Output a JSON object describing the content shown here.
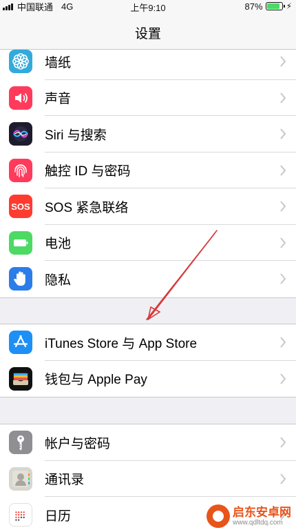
{
  "status_bar": {
    "carrier": "中国联通",
    "network": "4G",
    "time": "上午9:10",
    "battery_percent": "87%",
    "battery_level": 0.87,
    "charging_icon": "bolt-icon"
  },
  "nav": {
    "title": "设置"
  },
  "groups": [
    {
      "items": [
        {
          "label": "墙纸",
          "icon": "wallpaper-flower-icon",
          "color": "#34aadc"
        },
        {
          "label": "声音",
          "icon": "speaker-icon",
          "color": "#ff3b5c"
        },
        {
          "label": "Siri 与搜索",
          "icon": "siri-icon",
          "color": "#1c1c2e"
        },
        {
          "label": "触控 ID 与密码",
          "icon": "fingerprint-icon",
          "color": "#ff3b5c"
        },
        {
          "label": "SOS 紧急联络",
          "icon": "sos-icon",
          "color": "#ff3b30",
          "icon_text": "SOS"
        },
        {
          "label": "电池",
          "icon": "battery-icon",
          "color": "#4cd964"
        },
        {
          "label": "隐私",
          "icon": "hand-icon",
          "color": "#2b7de9"
        }
      ]
    },
    {
      "items": [
        {
          "label": "iTunes Store 与 App Store",
          "icon": "app-store-icon",
          "color": "#1e8ff5"
        },
        {
          "label": "钱包与 Apple Pay",
          "icon": "wallet-icon",
          "color": "#111111"
        }
      ]
    },
    {
      "items": [
        {
          "label": "帐户与密码",
          "icon": "key-icon",
          "color": "#8e8e93"
        },
        {
          "label": "通讯录",
          "icon": "contacts-icon",
          "color": "#c9c7c0"
        },
        {
          "label": "日历",
          "icon": "calendar-icon",
          "color": "#ffffff"
        }
      ]
    }
  ],
  "annotation": {
    "arrow_color": "#d63a3a"
  },
  "watermark": {
    "name": "启东安卓网",
    "url": "www.qdltdq.com"
  }
}
